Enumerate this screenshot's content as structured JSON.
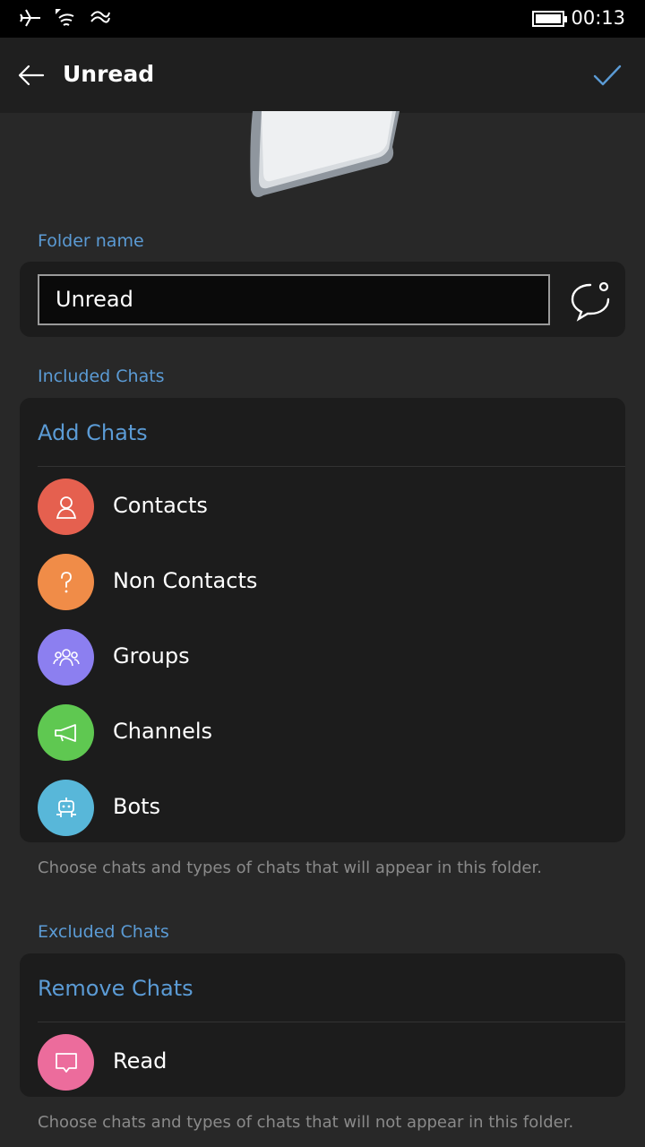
{
  "status_bar": {
    "time": "00:13",
    "icons": [
      "airplane-icon",
      "wifi-icon",
      "data-icon",
      "battery-icon"
    ]
  },
  "header": {
    "title": "Unread",
    "back_icon": "back-arrow-icon",
    "confirm_icon": "checkmark-icon",
    "accent": "#5b9bd5"
  },
  "folder_name": {
    "label": "Folder name",
    "value": "Unread",
    "emoji_icon": "emoji-chat-icon"
  },
  "included": {
    "label": "Included Chats",
    "add_label": "Add Chats",
    "items": [
      {
        "label": "Contacts",
        "icon": "person-icon",
        "color": "#e5604f"
      },
      {
        "label": "Non Contacts",
        "icon": "question-icon",
        "color": "#f08c48"
      },
      {
        "label": "Groups",
        "icon": "group-icon",
        "color": "#8c7ff0"
      },
      {
        "label": "Channels",
        "icon": "megaphone-icon",
        "color": "#5fc851"
      },
      {
        "label": "Bots",
        "icon": "bot-icon",
        "color": "#58b7d9"
      }
    ],
    "hint": "Choose chats and types of chats that will appear in this folder."
  },
  "excluded": {
    "label": "Excluded Chats",
    "remove_label": "Remove Chats",
    "items": [
      {
        "label": "Read",
        "icon": "read-chat-icon",
        "color": "#ec6c9c"
      }
    ],
    "hint": "Choose chats and types of chats that will not appear in this folder."
  }
}
